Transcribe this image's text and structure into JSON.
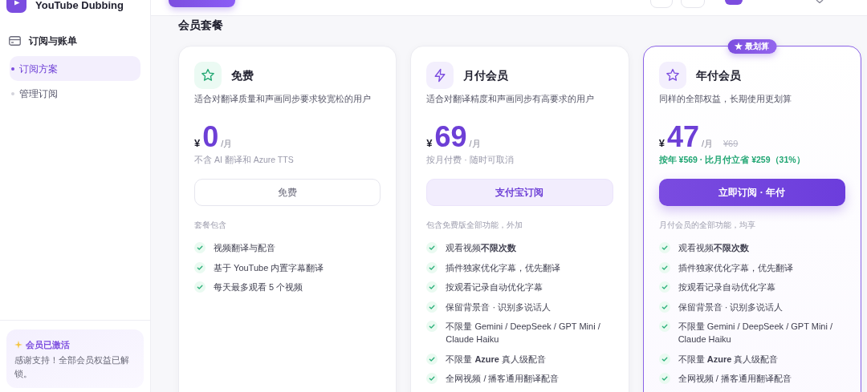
{
  "app": {
    "name": "YouTube Dubbing"
  },
  "sidebar": {
    "section": "订阅与账单",
    "items": [
      {
        "label": "订阅方案",
        "selected": true
      },
      {
        "label": "管理订阅",
        "selected": false
      }
    ],
    "status_card": {
      "title": "会员已激活",
      "message": "感谢支持！全部会员权益已解锁。"
    }
  },
  "page_title": "会员套餐",
  "plans": [
    {
      "kind": "free",
      "name": "免费",
      "description": "适合对翻译质量和声画同步要求较宽松的用户",
      "currency": "¥",
      "amount": "0",
      "period": "/月",
      "note": "不含 AI 翻译和 Azure TTS",
      "button": "免费",
      "features_title": "套餐包含",
      "features": [
        "视频翻译与配音",
        "基于 YouTube 内置字幕翻译",
        "每天最多观看 5 个视频"
      ]
    },
    {
      "kind": "monthly",
      "name": "月付会员",
      "description": "适合对翻译精度和声画同步有高要求的用户",
      "currency": "¥",
      "amount": "69",
      "period": "/月",
      "note": "按月付费 · 随时可取消",
      "button": "支付宝订阅",
      "features_title": "包含免费版全部功能，外加",
      "features": [
        "观看视频**不限次数**",
        "插件独家优化字幕，优先翻译",
        "按观看记录自动优化字幕",
        "保留背景音 · 识别多说话人",
        "不限量 Gemini / DeepSeek / GPT Mini / Claude Haiku",
        "不限量 **Azure** 真人级配音",
        "全网视频 / 播客通用翻译配音"
      ]
    },
    {
      "kind": "annual",
      "badge": "★ 最划算",
      "name": "年付会员",
      "description": "同样的全部权益，长期使用更划算",
      "currency": "¥",
      "amount": "47",
      "period": "/月",
      "original_price": "¥69",
      "savings": "按年 ¥569 · 比月付立省 ¥259（31%）",
      "button": "立即订阅 · 年付",
      "features_title": "月付会员的全部功能，均享",
      "features": [
        "观看视频**不限次数**",
        "插件独家优化字幕，优先翻译",
        "按观看记录自动优化字幕",
        "保留背景音 · 识别多说话人",
        "不限量 Gemini / DeepSeek / GPT Mini / Claude Haiku",
        "不限量 **Azure** 真人级配音",
        "全网视频 / 播客通用翻译配音"
      ]
    }
  ]
}
